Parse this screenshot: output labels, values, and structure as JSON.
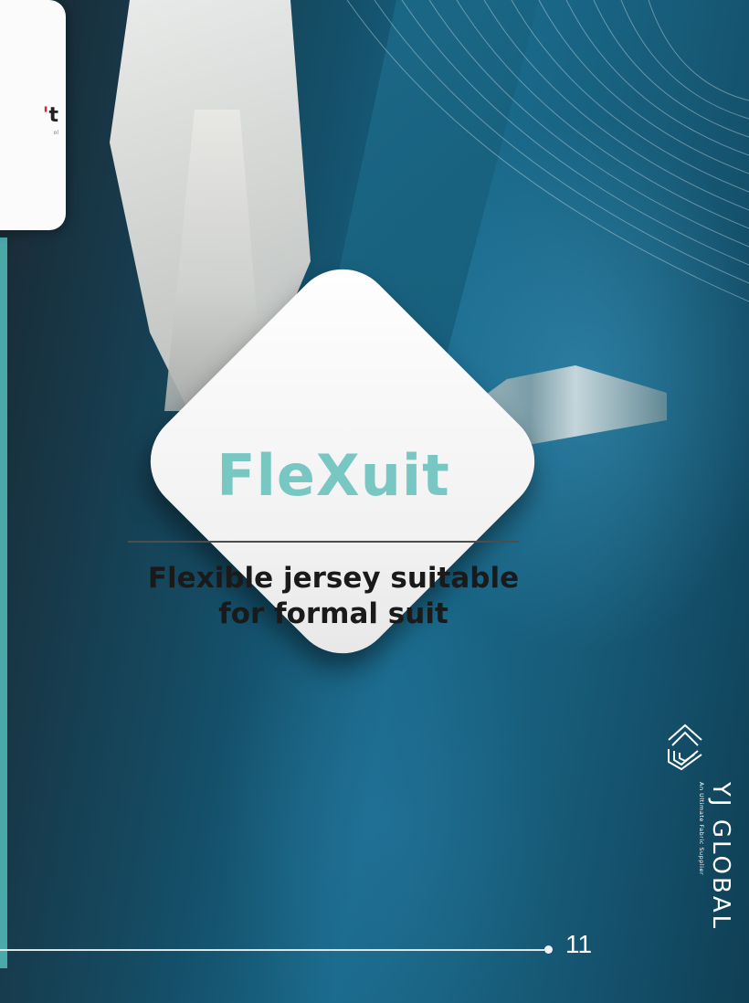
{
  "background": {
    "description_icon": "suit-jacket-photo",
    "accent": "#4aa8a8"
  },
  "card": {
    "partial_text": "t",
    "partial_text_red": "'",
    "small_text": "ol"
  },
  "feature": {
    "title": "FleXuit",
    "subtitle_line1": "Flexible jersey suitable",
    "subtitle_line2": "for formal suit",
    "title_color": "#79c7c3"
  },
  "footer": {
    "page_number": "11"
  },
  "brand": {
    "name": "YJ GLOBAL",
    "tagline": "An Ultimate Fabric Supplier",
    "logo_icon": "yj-global-logo-icon"
  }
}
